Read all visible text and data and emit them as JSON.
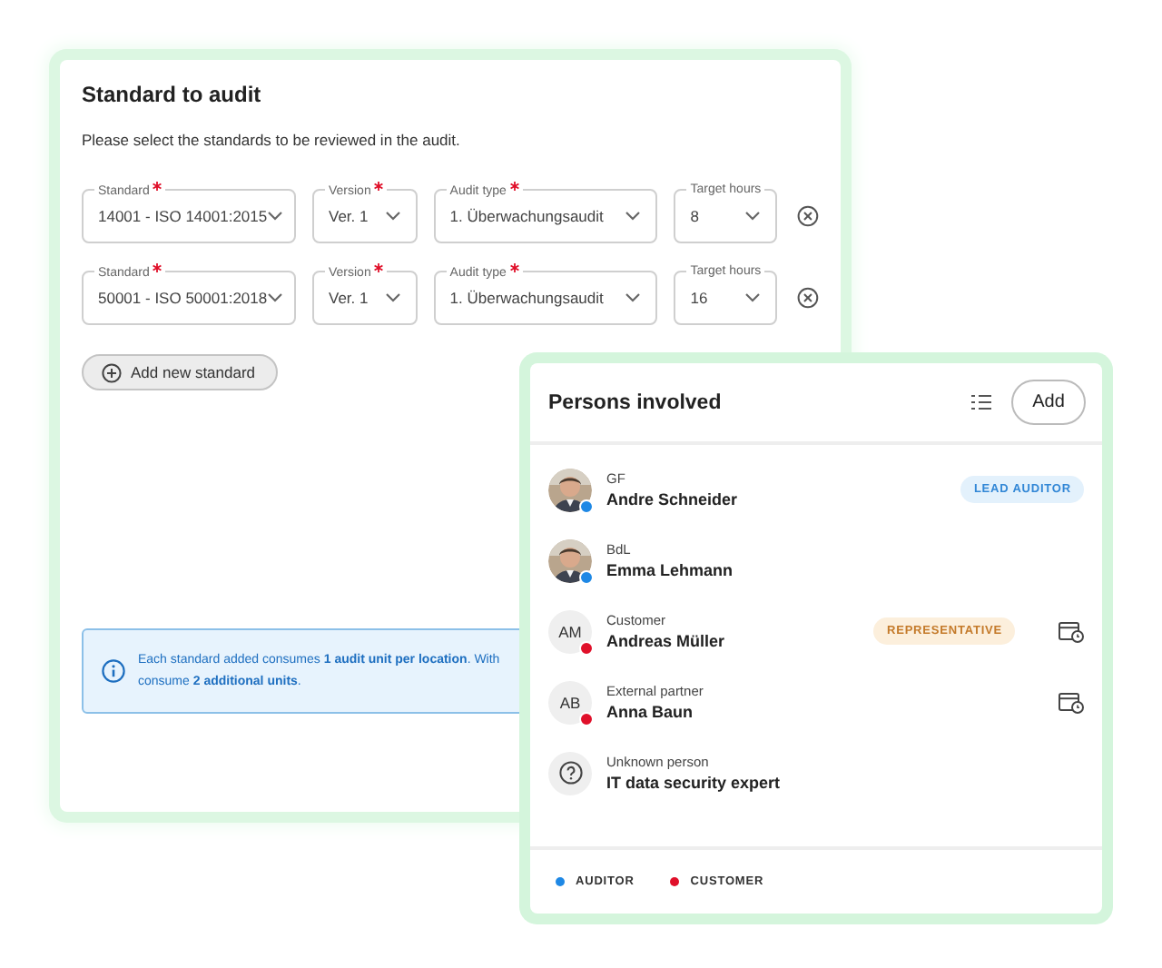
{
  "standards_card": {
    "title": "Standard to audit",
    "subtitle": "Please select the standards to be reviewed in the audit.",
    "rows": [
      {
        "fields": [
          {
            "label": "Standard",
            "required": true,
            "value": "14001 - ISO 14001:2015"
          },
          {
            "label": "Version",
            "required": true,
            "value": "Ver. 1"
          },
          {
            "label": "Audit type",
            "required": true,
            "value": "1. Überwachungsaudit"
          },
          {
            "label": "Target hours",
            "required": false,
            "value": "8"
          }
        ]
      },
      {
        "fields": [
          {
            "label": "Standard",
            "required": true,
            "value": "50001 - ISO 50001:2018"
          },
          {
            "label": "Version",
            "required": true,
            "value": "Ver. 1"
          },
          {
            "label": "Audit type",
            "required": true,
            "value": "1. Überwachungsaudit"
          },
          {
            "label": "Target hours",
            "required": false,
            "value": "16"
          }
        ]
      }
    ],
    "add_button": "Add new standard",
    "info_lines": [
      "Each standard added consumes **1 audit unit per location**. With",
      "consume **2 additional units**."
    ]
  },
  "persons_card": {
    "title": "Persons involved",
    "add_button": "Add",
    "persons": [
      {
        "role": "GF",
        "name": "Andre Schneider",
        "color": "#1e88e5",
        "badge": {
          "kind": "lead",
          "text": "LEAD AUDITOR"
        },
        "calendar": false
      },
      {
        "role": "BdL",
        "name": "Emma Lehmann",
        "color": "#1e88e5",
        "calendar": false
      },
      {
        "kind": "initials",
        "initials": "AM",
        "role": "Customer",
        "name": "Andreas Müller",
        "color": "#e0102a",
        "badge": {
          "kind": "representative",
          "text": "REPRESENTATIVE"
        },
        "calendar": true
      },
      {
        "kind": "initials",
        "initials": "AB",
        "role": "External partner",
        "name": "Anna Baun",
        "color": "#e0102a",
        "calendar": true
      },
      {
        "kind": "unknown",
        "role": "Unknown person",
        "name": "IT data security expert",
        "calendar": false
      }
    ],
    "legend": [
      {
        "label": "AUDITOR",
        "color": "#1e88e5"
      },
      {
        "label": "CUSTOMER",
        "color": "#e0102a"
      }
    ]
  }
}
